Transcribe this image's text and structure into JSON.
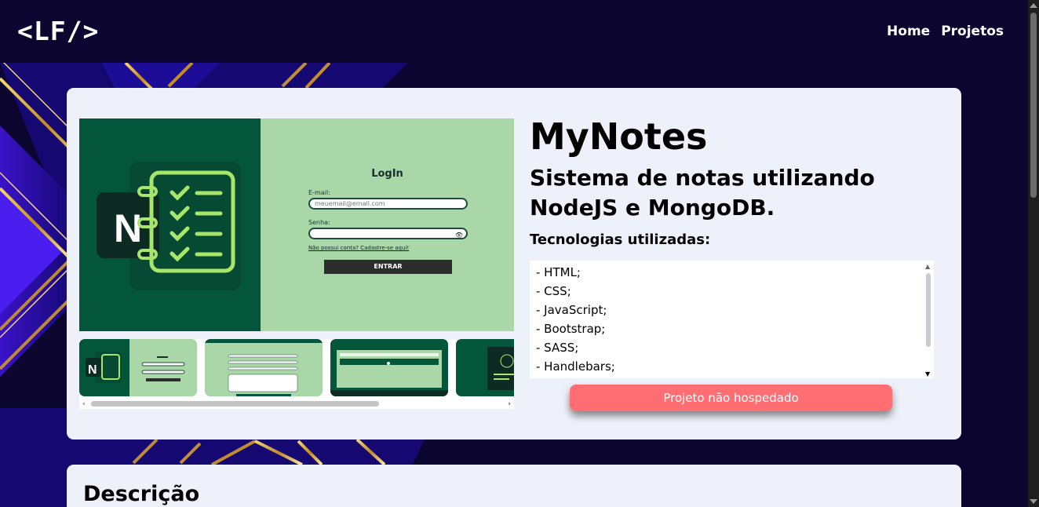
{
  "nav": {
    "logo": "<LF/>",
    "links": [
      "Home",
      "Projetos"
    ]
  },
  "project": {
    "title": "MyNotes",
    "subtitle": "Sistema de notas utilizando NodeJS e MongoDB.",
    "tech_heading": "Tecnologias utilizadas:",
    "technologies": [
      "- HTML;",
      "- CSS;",
      "- JavaScript;",
      "- Bootstrap;",
      "- SASS;",
      "- Handlebars;"
    ],
    "host_button": "Projeto não hospedado"
  },
  "screenshot": {
    "logo_letter": "N",
    "login_title": "LogIn",
    "email_label": "E-mail:",
    "email_placeholder": "meuemail@email.com",
    "password_label": "Senha:",
    "signup_link": "Não possui conta? Cadastre-se aqui!",
    "submit_label": "ENTRAR"
  },
  "thumbnails": [
    {
      "name": "thumbnail-login"
    },
    {
      "name": "thumbnail-form"
    },
    {
      "name": "thumbnail-notes"
    },
    {
      "name": "thumbnail-dark"
    }
  ],
  "description": {
    "heading": "Descrição"
  },
  "colors": {
    "nav_bg": "#0c0530",
    "card_bg": "#eef1fa",
    "button_bg": "#ff6e72",
    "screenshot_dark": "#03563a",
    "screenshot_light": "#aad7a8",
    "icon_green": "#a8e66b"
  }
}
